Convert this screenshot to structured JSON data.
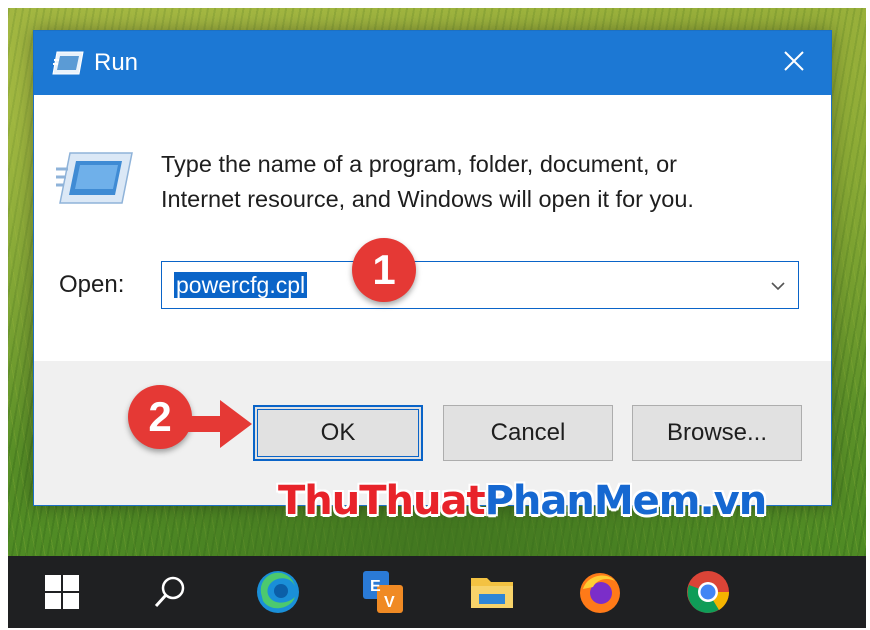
{
  "dialog": {
    "title": "Run",
    "description_line1": "Type the name of a program, folder, document, or",
    "description_line2": "Internet resource, and Windows will open it for you.",
    "open_label": "Open:",
    "open_value": "powercfg.cpl",
    "buttons": {
      "ok": "OK",
      "cancel": "Cancel",
      "browse": "Browse..."
    },
    "icons": {
      "title": "run-icon",
      "content": "run-icon",
      "close": "close-icon",
      "dropdown": "chevron-down-icon"
    }
  },
  "annotations": {
    "step1": "1",
    "step2": "2"
  },
  "watermark": {
    "part1": "ThuThuat",
    "part2": "PhanMem.vn"
  },
  "taskbar": {
    "items": [
      "windows-start-icon",
      "search-icon",
      "edge-icon",
      "taskbar-app-icon",
      "file-explorer-icon",
      "firefox-icon",
      "chrome-icon"
    ]
  },
  "colors": {
    "accent": "#1c78d4",
    "selection": "#0a64c8",
    "badge": "#e53935",
    "taskbar": "#1f2022"
  }
}
